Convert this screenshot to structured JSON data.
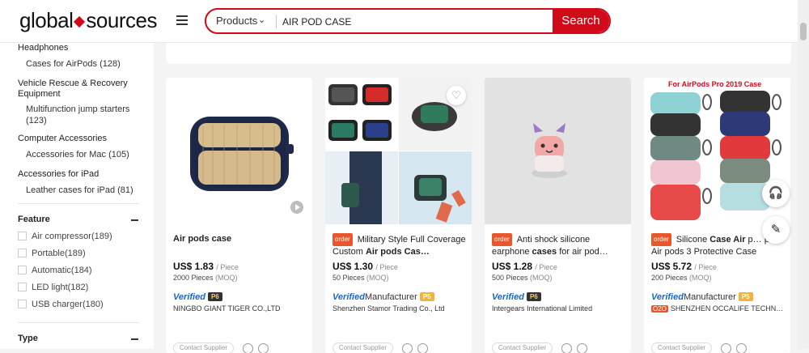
{
  "header": {
    "logo_left": "global",
    "logo_right": "sources",
    "search_category": "Products",
    "search_value": "AIR POD CASE",
    "search_button": "Search"
  },
  "sidebar": {
    "categories": [
      {
        "group": "Headphones",
        "sub": "Cases for AirPods (128)"
      },
      {
        "group": "Vehicle Rescue & Recovery Equipment",
        "sub": "Multifunction jump starters (123)"
      },
      {
        "group": "Computer Accessories",
        "sub": "Accessories for Mac (105)"
      },
      {
        "group": "Accessories for iPad",
        "sub": "Leather cases for iPad (81)"
      }
    ],
    "feature_heading": "Feature",
    "features": [
      "Air compressor(189)",
      "Portable(189)",
      "Automatic(184)",
      "LED light(182)",
      "USB charger(180)"
    ],
    "type_heading": "Type"
  },
  "products": [
    {
      "badge": "",
      "title_pre": "",
      "title_bold": "Air pods case",
      "title_post": "",
      "price": "US$ 1.83",
      "unit": "/ Piece",
      "moq": "2000 Pieces",
      "moq_label": "(MOQ)",
      "verified": "Verified",
      "manufacturer": "",
      "pbadge": "P6",
      "pbadge_dark": true,
      "o2o": "",
      "supplier": "NINGBO GIANT TIGER CO.,LTD",
      "contact": "Contact Supplier"
    },
    {
      "badge": "order",
      "title_pre": "Military Style Full Coverage Custom ",
      "title_bold": "Air pods Cas…",
      "title_post": "",
      "price": "US$ 1.30",
      "unit": "/ Piece",
      "moq": "50 Pieces",
      "moq_label": "(MOQ)",
      "verified": "Verified",
      "manufacturer": "Manufacturer",
      "pbadge": "P5",
      "pbadge_dark": false,
      "o2o": "",
      "supplier": "Shenzhen Stamor Trading Co., Ltd",
      "contact": "Contact Supplier"
    },
    {
      "badge": "order",
      "title_pre": "Anti shock silicone earphone ",
      "title_bold": "cases",
      "title_post": " for air pod…",
      "price": "US$ 1.28",
      "unit": "/ Piece",
      "moq": "500 Pieces",
      "moq_label": "(MOQ)",
      "verified": "Verified",
      "manufacturer": "",
      "pbadge": "P6",
      "pbadge_dark": true,
      "o2o": "",
      "supplier": "Intergears International Limited",
      "contact": "Contact Supplier"
    },
    {
      "badge": "order",
      "title_pre": "Silicone ",
      "title_bold": "Case Air",
      "title_post": " p… pro Air pods 3 Protective Case",
      "price": "US$ 5.72",
      "unit": "/ Piece",
      "moq": "200 Pieces",
      "moq_label": "(MOQ)",
      "verified": "Verified",
      "manufacturer": "Manufacturer",
      "pbadge": "P5",
      "pbadge_dark": false,
      "o2o": "O2O",
      "supplier": "SHENZHEN OCCALIFE TECHN…",
      "contact": "Contact Supplier"
    }
  ],
  "promo_text": "For AirPods Pro 2019 Case",
  "colors": {
    "brand_red": "#d10a1a",
    "verified_blue": "#1a66c8",
    "order_badge": "#e8572b",
    "p5_badge": "#f4b23c"
  }
}
